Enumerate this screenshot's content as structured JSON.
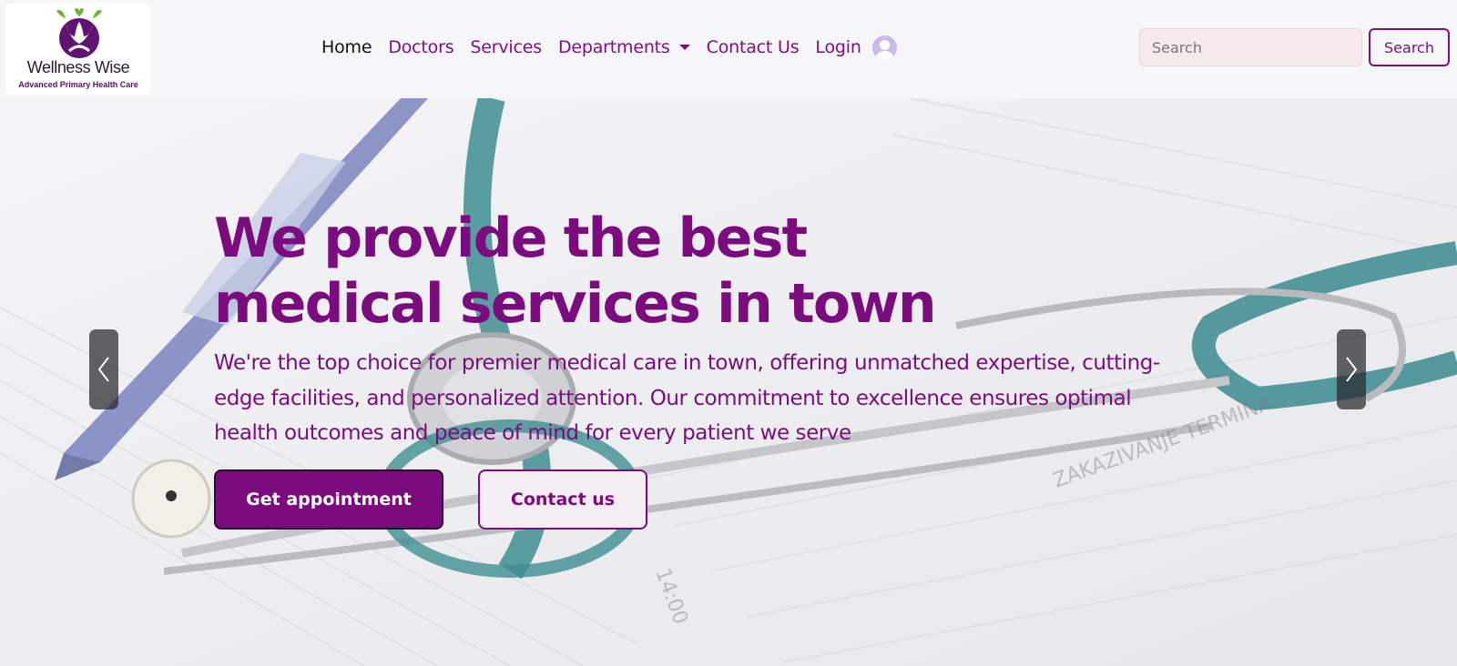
{
  "brand": {
    "name": "Wellness Wise",
    "tagline": "Advanced Primary Health Care",
    "colors": {
      "primary": "#7b0c7e",
      "leaf": "#6bb52e"
    }
  },
  "nav": {
    "items": [
      {
        "label": "Home",
        "active": true
      },
      {
        "label": "Doctors"
      },
      {
        "label": "Services"
      },
      {
        "label": "Departments",
        "dropdown": true
      },
      {
        "label": "Contact Us"
      },
      {
        "label": "Login",
        "icon": "user-avatar-icon"
      }
    ]
  },
  "search": {
    "placeholder": "Search",
    "button_label": "Search"
  },
  "hero": {
    "title": "We provide the best medical services in town",
    "text": "We're the top choice for premier medical care in town, offering unmatched expertise, cutting-edge facilities, and personalized attention. Our commitment to excellence ensures optimal health outcomes and peace of mind for every patient we serve",
    "primary_button": "Get appointment",
    "secondary_button": "Contact us"
  },
  "carousel": {
    "prev_icon": "chevron-left-icon",
    "next_icon": "chevron-right-icon"
  }
}
